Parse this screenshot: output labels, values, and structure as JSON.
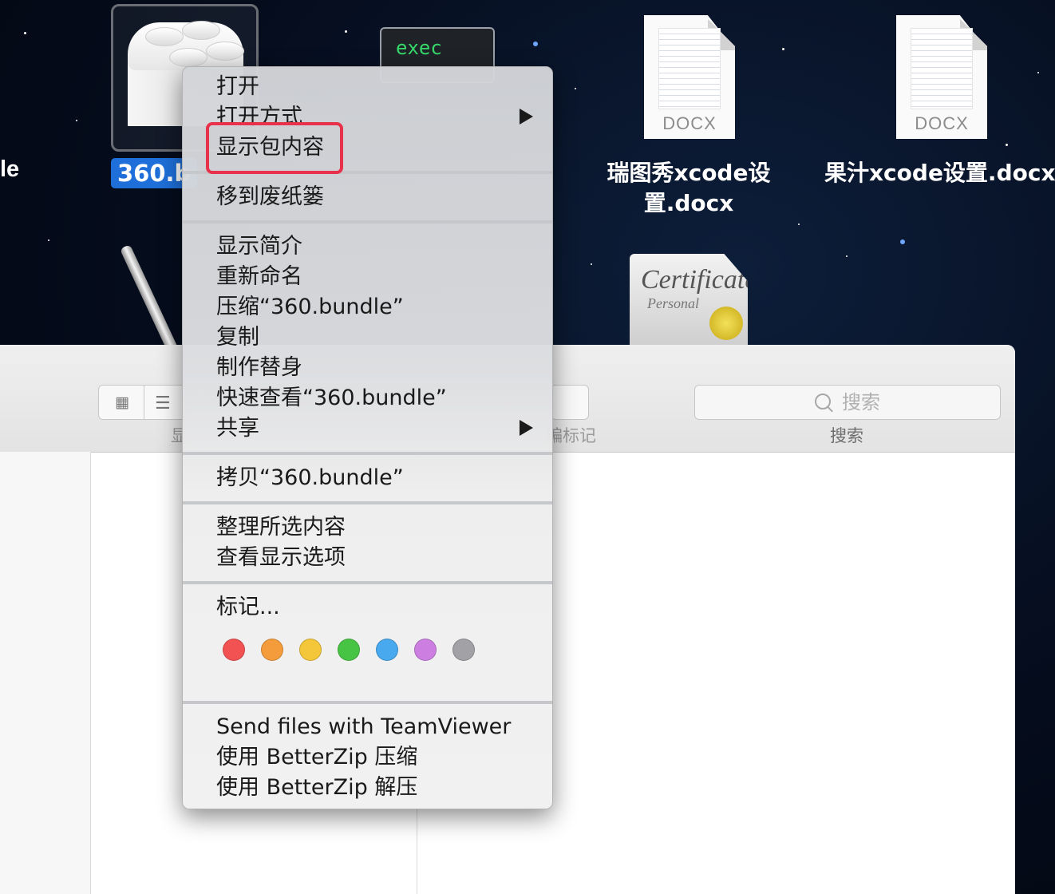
{
  "desktop": {
    "left_partial_label": "le",
    "bundle": {
      "label": "360.b"
    },
    "exec": {
      "label": "exec"
    },
    "docs": [
      {
        "ext": "DOCX",
        "caption_line1": "瑞图秀xcode设",
        "caption_line2": "置.docx"
      },
      {
        "ext": "DOCX",
        "caption_line1": "果汁xcode设置.docx"
      }
    ],
    "certificate": {
      "title": "Certificate",
      "subtitle": "Personal"
    }
  },
  "finder": {
    "toolbar": {
      "show_label": "显",
      "tag_label": "编标记",
      "search_placeholder": "搜索",
      "search_label": "搜索"
    }
  },
  "menu": {
    "items": {
      "open": "打开",
      "open_with": "打开方式",
      "show_package": "显示包内容",
      "trash": "移到废纸篓",
      "get_info": "显示简介",
      "rename": "重新命名",
      "compress": "压缩“360.bundle”",
      "duplicate": "复制",
      "alias": "制作替身",
      "quicklook": "快速查看“360.bundle”",
      "share": "共享",
      "copy": "拷贝“360.bundle”",
      "cleanup": "整理所选内容",
      "view_options": "查看显示选项",
      "tags": "标记...",
      "teamviewer": "Send files with TeamViewer",
      "bz_compress": "使用 BetterZip 压缩",
      "bz_extract": "使用 BetterZip 解压"
    },
    "tag_colors": [
      "#f25252",
      "#f49c3b",
      "#f4c73a",
      "#48c444",
      "#48a9ee",
      "#cc7fe0",
      "#a2a2a6"
    ],
    "highlight_color": "#e8314a"
  }
}
